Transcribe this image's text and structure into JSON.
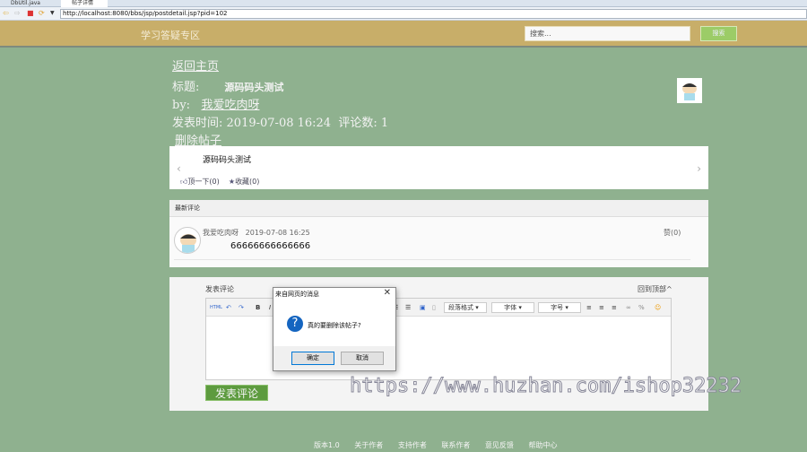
{
  "browser": {
    "tabs": [
      "DbUtil.java",
      "帖子详情"
    ],
    "url": "http://localhost:8080/bbs/jsp/postdetail.jsp?pid=102"
  },
  "header": {
    "site_title": "学习答疑专区",
    "search_placeholder": "搜索...",
    "search_button": "搜索"
  },
  "post": {
    "back_link": "返回主页",
    "title_label": "标题:",
    "title": "源码码头测试",
    "by_label": "by:",
    "author": "我爱吃肉呀",
    "time_label": "发表时间:",
    "time": "2019-07-08 16:24",
    "comment_count_label": "评论数:",
    "comment_count": "1",
    "delete_link": "删除帖子",
    "content": "源码码头测试",
    "like": "顶一下(0)",
    "favorite": "收藏(0)"
  },
  "comments": {
    "header": "最新评论",
    "items": [
      {
        "author": "我爱吃肉呀",
        "time": "2019-07-08 16:25",
        "body": "66666666666666",
        "like": "赞(0)"
      }
    ]
  },
  "editor": {
    "label": "发表评论",
    "back_to_top": "回到顶部^",
    "paragraph": "段落格式",
    "font": "字体",
    "size": "字号",
    "submit": "发表评论"
  },
  "dialog": {
    "title": "来自网页的消息",
    "message": "真的要删除该帖子?",
    "ok": "确定",
    "cancel": "取消"
  },
  "watermark": "https://www.huzhan.com/ishop32232",
  "footer": [
    "版本1.0",
    "关于作者",
    "支持作者",
    "联系作者",
    "意见反馈",
    "帮助中心"
  ]
}
